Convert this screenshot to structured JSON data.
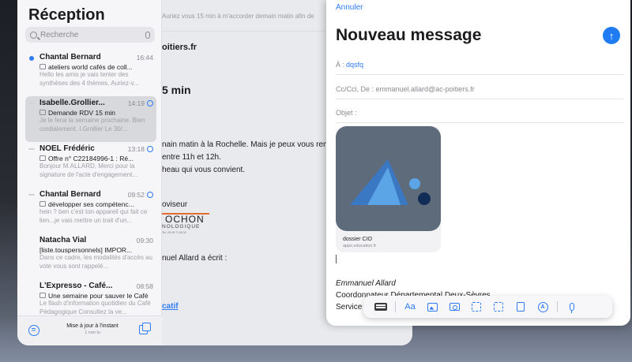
{
  "inbox": {
    "title": "Réception",
    "search_placeholder": "Recherche",
    "messages": [
      {
        "sender": "Chantal Bernard",
        "time": "16:44",
        "subject": "ateliers world cafés de coll...",
        "preview": "Hello les amis je vais tenter des synthèses des 4 thèmes. Auriez-v...",
        "unread": true
      },
      {
        "sender": "Isabelle.Grollier...",
        "time": "14:19",
        "subject": "Demande RDV 15 min",
        "preview": "Je le ferai la semaine prochaine. Bien cordialement. I.Grollier Le 30/...",
        "selected": true
      },
      {
        "sender": "NOEL Frédéric",
        "time": "13:18",
        "subject": "Offre n° C22184996-1 : Ré...",
        "preview": "Bonjour M.ALLARD, Merci pour la signature de l'acte d'engagement..."
      },
      {
        "sender": "Chantal Bernard",
        "time": "09:52",
        "subject": "développer ses compétenc...",
        "preview": "hein ? ben c'est ton appareil qui fait ce lien...je vais mettre un trait d'un..."
      },
      {
        "sender": "Natacha Vial",
        "time": "09:30",
        "subject": "[liste.touspersonnels] IMPOR...",
        "preview": "Dans ce cadre, les modalités d'accès au vote vous sont rappelé..."
      },
      {
        "sender": "L'Expresso - Café...",
        "time": "08:58",
        "subject": "Une semaine pour sauver le Café",
        "preview": "Le flash d'information quotidien du Café Pédagogique Consultez la ve..."
      }
    ],
    "footer_main": "Mise à jour à l'instant",
    "footer_sub": "1 non lu"
  },
  "reader": {
    "top_preview": "Auriez vous 15 min à m'accorder demain matin afin de",
    "from": "oitiers.fr",
    "subject": "5 min",
    "body_line1": "nain matin à la Rochelle. Mais je peux vous renco",
    "body_line2": "entre 11h et 12h.",
    "body_line3": "heau qui vous convient.",
    "sig_title": "oviseur",
    "logo_big": "OCHON",
    "logo_small": "NOLOGIQUE",
    "logo_tiny": "Tel : 05 49 71 08 00",
    "quote": "nuel Allard a écrit :",
    "link": "catif"
  },
  "compose": {
    "cancel": "Annuler",
    "title": "Nouveau message",
    "to_label": "À :",
    "to_value": "dqsfq",
    "cc_label": "Cc/Cci, De : emmanuel.allard@ac-poitiers.fr",
    "subject_label": "Objet :",
    "attachment_title": "dossier CIO",
    "attachment_url": "apps.education.fr",
    "sig_name": "Emmanuel Allard",
    "sig_role": "Coordonnateur Départemental Deux-Sèvres",
    "sig_service": "Service"
  },
  "toolbar": {
    "format_label": "Aa"
  },
  "colors": {
    "accent": "#2f7bf6",
    "app_icon_bg": "#5e6b7a",
    "logo_dark": "#3b78c4",
    "logo_light": "#5ba4e6",
    "logo_navy": "#112c57"
  }
}
